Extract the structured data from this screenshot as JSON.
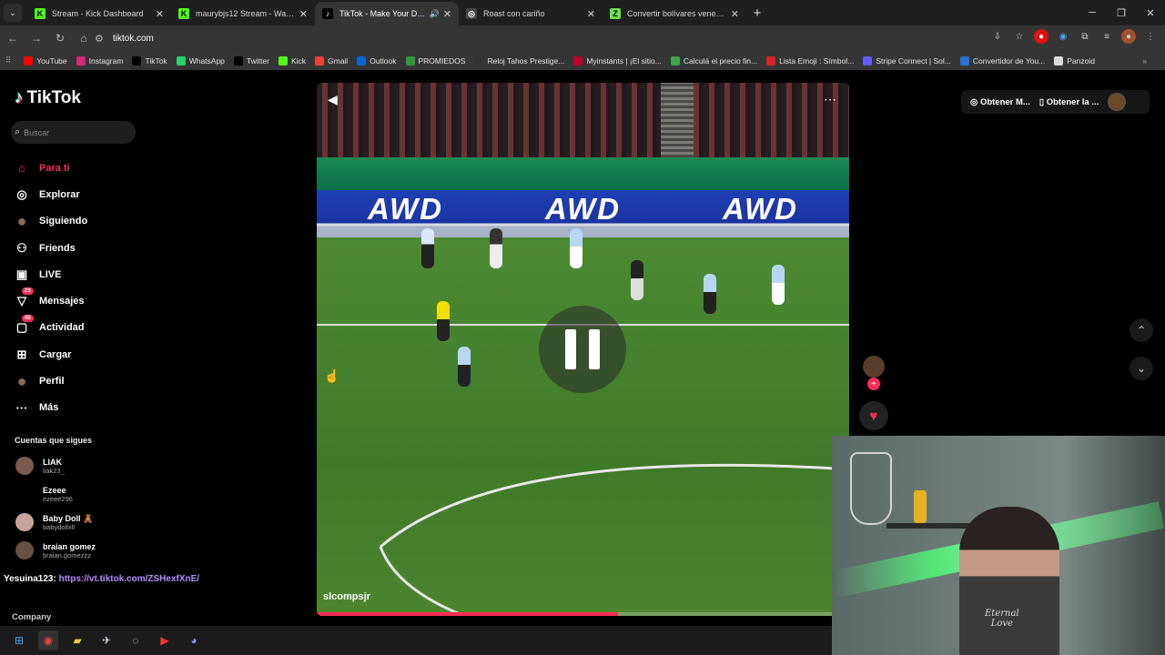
{
  "tabs": [
    {
      "title": "Stream - Kick Dashboard",
      "fav": "K",
      "fav_color": "#53fc18",
      "active": false
    },
    {
      "title": "maurybjs12 Stream - Watch Live",
      "fav": "K",
      "fav_color": "#53fc18",
      "active": false
    },
    {
      "title": "TikTok - Make Your Day",
      "fav": "♪",
      "fav_color": "#000000",
      "active": true
    },
    {
      "title": "Roast con cariño",
      "fav": "◎",
      "fav_color": "#444444",
      "active": false
    },
    {
      "title": "Convertir bolívares venezolanos",
      "fav": "Z",
      "fav_color": "#6ee04a",
      "active": false
    }
  ],
  "address": {
    "url": "tiktok.com"
  },
  "bookmarks": [
    {
      "label": "YouTube",
      "color": "#ff0000"
    },
    {
      "label": "Instagram",
      "color": "#d62976"
    },
    {
      "label": "TikTok",
      "color": "#000000"
    },
    {
      "label": "WhatsApp",
      "color": "#25d366"
    },
    {
      "label": "Twitter",
      "color": "#000000"
    },
    {
      "label": "Kick",
      "color": "#53fc18"
    },
    {
      "label": "Gmail",
      "color": "#ea4335"
    },
    {
      "label": "Outlook",
      "color": "#0a64d6"
    },
    {
      "label": "PROMIEDOS",
      "color": "#2e9a3b"
    },
    {
      "label": "Reloj Tahos Prestige...",
      "color": "#333333"
    },
    {
      "label": "Myinstants | ¡El sitio...",
      "color": "#c0002b"
    },
    {
      "label": "Calculá el precio fin...",
      "color": "#3fa34d"
    },
    {
      "label": "Lista Emoji : Símbol...",
      "color": "#d22"
    },
    {
      "label": "Stripe Connect | Sol...",
      "color": "#635bff"
    },
    {
      "label": "Convertidor de You...",
      "color": "#2a6fd6"
    },
    {
      "label": "Panzoid",
      "color": "#dddddd"
    }
  ],
  "sidebar": {
    "logo": "TikTok",
    "search_placeholder": "Buscar",
    "nav": [
      {
        "label": "Para ti",
        "icon": "home-icon",
        "glyph": "⌂",
        "active": true
      },
      {
        "label": "Explorar",
        "icon": "compass-icon",
        "glyph": "◎",
        "active": false
      },
      {
        "label": "Siguiendo",
        "icon": "following-avatar-icon",
        "glyph": "●",
        "active": false
      },
      {
        "label": "Friends",
        "icon": "friends-icon",
        "glyph": "⚇",
        "active": false
      },
      {
        "label": "LIVE",
        "icon": "live-icon",
        "glyph": "▣",
        "active": false
      },
      {
        "label": "Mensajes",
        "icon": "messages-icon",
        "glyph": "▽",
        "badge": "23",
        "active": false
      },
      {
        "label": "Actividad",
        "icon": "activity-icon",
        "glyph": "▢",
        "badge": "45",
        "active": false
      },
      {
        "label": "Cargar",
        "icon": "upload-icon",
        "glyph": "⊞",
        "active": false
      },
      {
        "label": "Perfil",
        "icon": "profile-avatar-icon",
        "glyph": "●",
        "active": false
      },
      {
        "label": "Más",
        "icon": "more-icon",
        "glyph": "···",
        "active": false
      }
    ],
    "following_title": "Cuentas que sigues",
    "accounts": [
      {
        "name": "LIAK",
        "handle": "liak23_"
      },
      {
        "name": "Ezeee",
        "handle": "ezeee296"
      },
      {
        "name": "Baby Doll 🧸",
        "handle": "babydollxll"
      },
      {
        "name": "braian gomez",
        "handle": "braian.gomezzz"
      }
    ],
    "company": "Company"
  },
  "chat": {
    "user": "Yesuina123",
    "sep": ": ",
    "link": "https://vt.tiktok.com/ZSHexfXnE/"
  },
  "video": {
    "ad_text": "AWD",
    "author": "slcompsjr",
    "progress": 0.565
  },
  "top_buttons": {
    "coins": "Obtener M...",
    "app": "Obtener la ..."
  },
  "webcam": {
    "shirt_line1": "Eternal",
    "shirt_line2": "Love"
  }
}
